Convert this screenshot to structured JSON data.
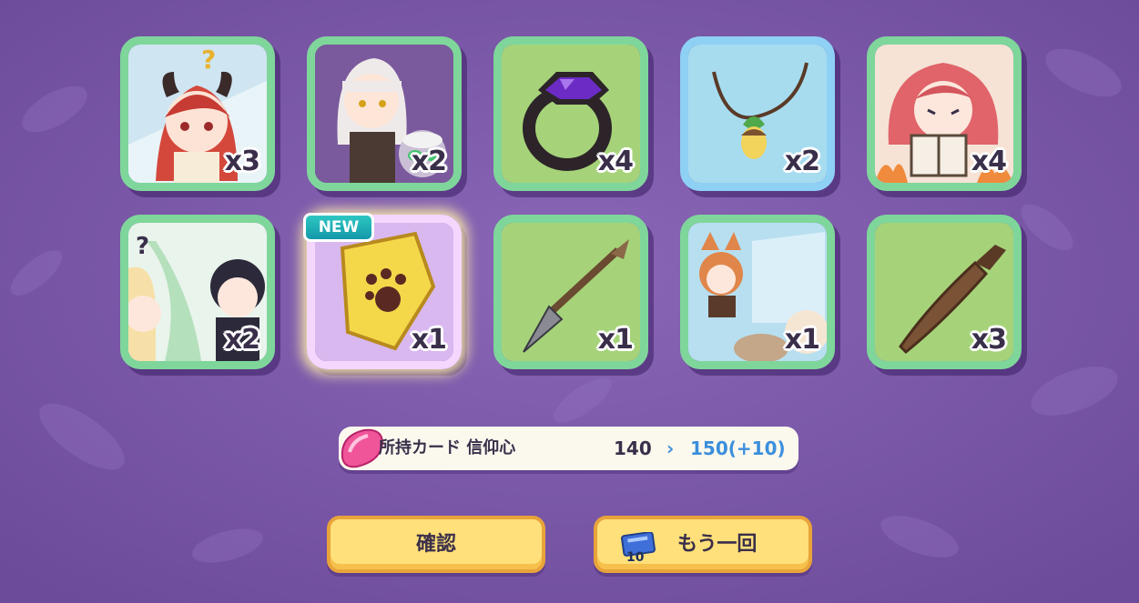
{
  "cards": [
    {
      "name": "succubus-girl-card",
      "qty": "x3",
      "frame": "green"
    },
    {
      "name": "white-hair-girl-card",
      "qty": "x2",
      "frame": "green"
    },
    {
      "name": "purple-gem-ring-card",
      "qty": "x4",
      "frame": "green"
    },
    {
      "name": "acorn-necklace-card",
      "qty": "x2",
      "frame": "blue"
    },
    {
      "name": "reading-girl-card",
      "qty": "x4",
      "frame": "green"
    },
    {
      "name": "blonde-and-dark-hair-card",
      "qty": "x2",
      "frame": "green"
    },
    {
      "name": "paw-print-plate-card",
      "qty": "x1",
      "frame": "rainbow",
      "badge": "NEW"
    },
    {
      "name": "spear-card",
      "qty": "x1",
      "frame": "green"
    },
    {
      "name": "fox-girl-ghost-card",
      "qty": "x1",
      "frame": "green"
    },
    {
      "name": "wooden-dagger-card",
      "qty": "x3",
      "frame": "green"
    }
  ],
  "faith": {
    "label": "所持カード 信仰心",
    "old": "140",
    "arrow": "›",
    "new": "150(+10)"
  },
  "buttons": {
    "confirm": "確認",
    "again": "もう一回",
    "ticket_count": "10"
  }
}
